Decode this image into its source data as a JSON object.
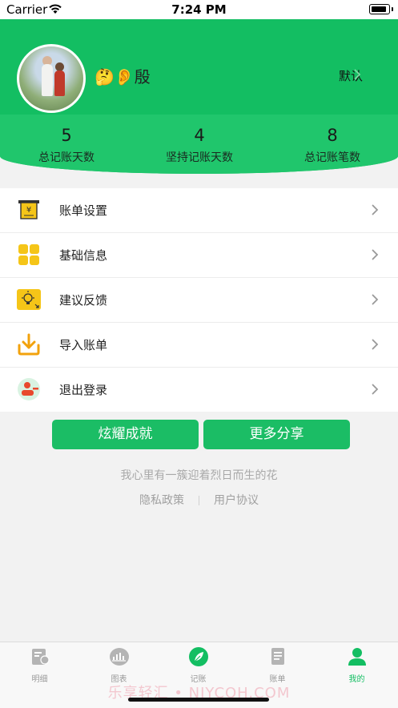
{
  "status_bar": {
    "carrier": "Carrier",
    "time": "7:24 PM"
  },
  "profile": {
    "nickname": "🤔👂殷",
    "default_link": "默认"
  },
  "stats": [
    {
      "value": "5",
      "label": "总记账天数"
    },
    {
      "value": "4",
      "label": "坚持记账天数"
    },
    {
      "value": "8",
      "label": "总记账笔数"
    }
  ],
  "menu": [
    {
      "label": "账单设置",
      "icon": "bill-settings-icon"
    },
    {
      "label": "基础信息",
      "icon": "grid-icon"
    },
    {
      "label": "建议反馈",
      "icon": "lightbulb-icon"
    },
    {
      "label": "导入账单",
      "icon": "download-icon"
    },
    {
      "label": "退出登录",
      "icon": "logout-user-icon"
    }
  ],
  "buttons": {
    "achievement": "炫耀成就",
    "share": "更多分享"
  },
  "motto": "我心里有一簇迎着烈日而生的花",
  "links": {
    "privacy": "隐私政策",
    "agreement": "用户协议"
  },
  "tabs": [
    {
      "label": "明细",
      "icon": "detail-icon"
    },
    {
      "label": "图表",
      "icon": "chart-icon"
    },
    {
      "label": "记账",
      "icon": "leaf-icon"
    },
    {
      "label": "账单",
      "icon": "bill-icon"
    },
    {
      "label": "我的",
      "icon": "profile-icon"
    }
  ],
  "active_tab": "我的",
  "watermark": "乐享轻汇 • NJYCOH.COM",
  "colors": {
    "brand_green": "#13be62",
    "accent_yellow": "#f5c518"
  }
}
